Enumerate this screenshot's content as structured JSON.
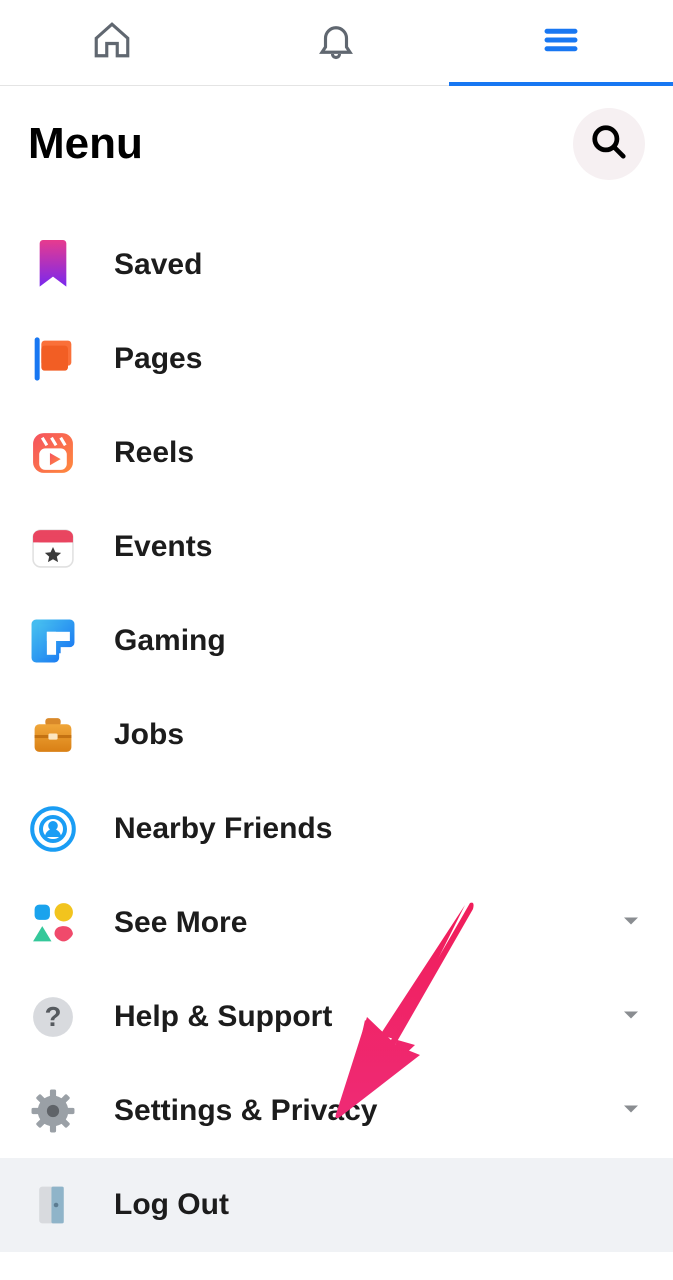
{
  "header": {
    "title": "Menu"
  },
  "items": {
    "saved": "Saved",
    "pages": "Pages",
    "reels": "Reels",
    "events": "Events",
    "gaming": "Gaming",
    "jobs": "Jobs",
    "nearby": "Nearby Friends",
    "more": "See More",
    "help": "Help & Support",
    "settings": "Settings & Privacy",
    "logout": "Log Out"
  }
}
